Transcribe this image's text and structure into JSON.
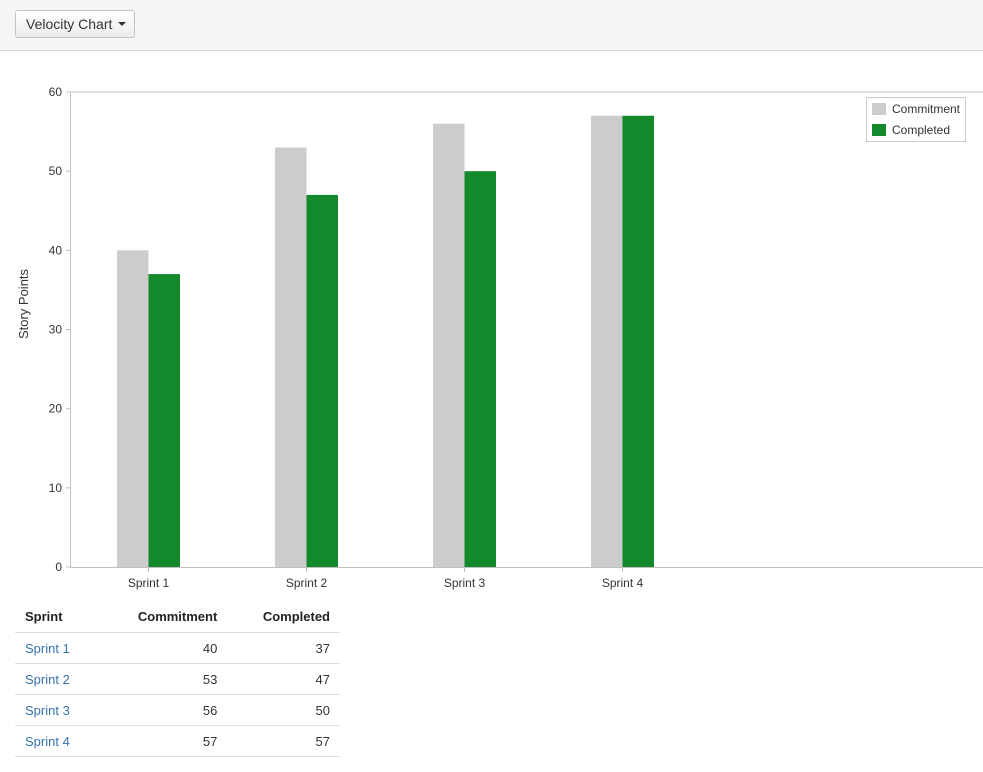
{
  "toolbar": {
    "report_select_label": "Velocity Chart"
  },
  "chart_data": {
    "type": "bar",
    "categories": [
      "Sprint 1",
      "Sprint 2",
      "Sprint 3",
      "Sprint 4"
    ],
    "series": [
      {
        "name": "Commitment",
        "values": [
          40,
          53,
          56,
          57
        ],
        "color": "#cccccc"
      },
      {
        "name": "Completed",
        "values": [
          37,
          47,
          50,
          57
        ],
        "color": "#14892c"
      }
    ],
    "ylabel": "Story Points",
    "xlabel": "",
    "ylim": [
      0,
      60
    ],
    "yticks": [
      0,
      10,
      20,
      30,
      40,
      50,
      60
    ],
    "legend_position": "top-right",
    "grid": false
  },
  "table": {
    "headers": [
      "Sprint",
      "Commitment",
      "Completed"
    ],
    "rows": [
      {
        "sprint": "Sprint 1",
        "commitment": "40",
        "completed": "37"
      },
      {
        "sprint": "Sprint 2",
        "commitment": "53",
        "completed": "47"
      },
      {
        "sprint": "Sprint 3",
        "commitment": "56",
        "completed": "50"
      },
      {
        "sprint": "Sprint 4",
        "commitment": "57",
        "completed": "57"
      }
    ]
  }
}
